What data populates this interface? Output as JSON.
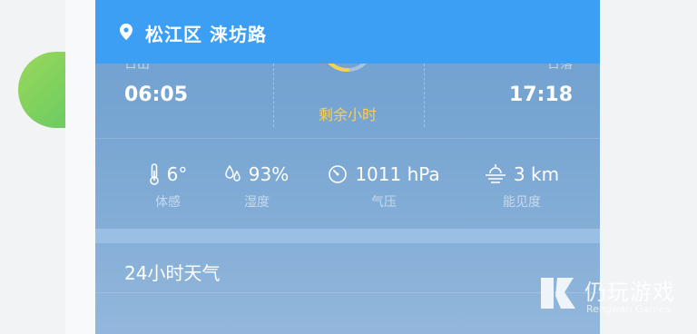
{
  "header": {
    "location": "松江区 涞坊路"
  },
  "sun": {
    "sunrise_label": "日出",
    "sunrise_time": "06:05",
    "sunset_label": "日落",
    "sunset_time": "17:18",
    "remain_label": "剩余小时"
  },
  "stats": [
    {
      "icon": "thermometer-icon",
      "value": "6°",
      "label": "体感"
    },
    {
      "icon": "humidity-icon",
      "value": "93%",
      "label": "湿度"
    },
    {
      "icon": "pressure-gauge-icon",
      "value": "1011 hPa",
      "label": "气压"
    },
    {
      "icon": "visibility-icon",
      "value": "3 km",
      "label": "能见度"
    }
  ],
  "forecast": {
    "title": "24小时天气"
  },
  "watermark": {
    "text": "仍玩游戏",
    "sub": "Rengwan Games"
  },
  "colors": {
    "header": "#3d9ff3",
    "accent_yellow": "#f6cf5a",
    "panel": "#7aa7d3"
  }
}
